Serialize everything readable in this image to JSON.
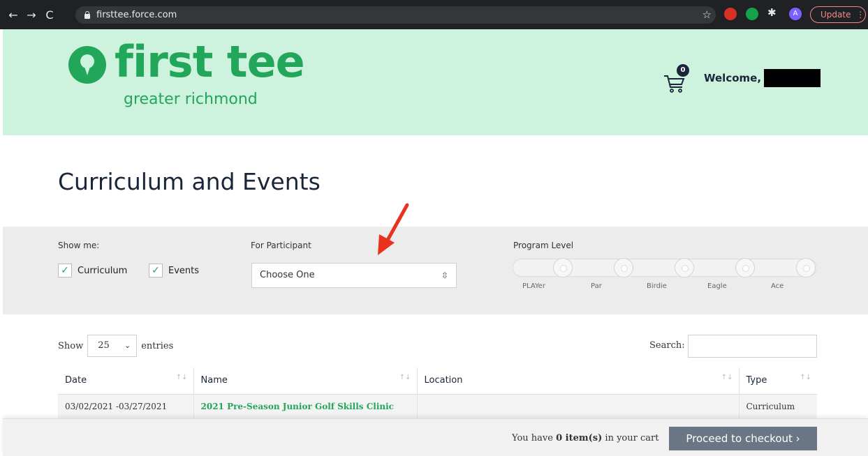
{
  "browser": {
    "url": "firsttee.force.com",
    "update_label": "Update",
    "avatar_letter": "A",
    "nav_back": "←",
    "nav_forward": "→",
    "nav_reload": "C",
    "star": "☆",
    "puzzle": "✱",
    "update_menu": "⋮"
  },
  "header": {
    "logo_text": "first tee",
    "logo_sub": "greater richmond",
    "cart_count": "0",
    "welcome": "Welcome,"
  },
  "page": {
    "title": "Curriculum and Events"
  },
  "filters": {
    "show_me_label": "Show me:",
    "curriculum_label": "Curriculum",
    "events_label": "Events",
    "participant_label": "For Participant",
    "participant_value": "Choose One",
    "program_level_label": "Program Level",
    "levels": [
      "PLAYer",
      "Par",
      "Birdie",
      "Eagle",
      "Ace"
    ],
    "check_glyph": "✓",
    "select_chevron": "⌃⌄"
  },
  "table": {
    "show_label": "Show",
    "entries_value": "25",
    "entries_label": "entries",
    "search_label": "Search:",
    "sort_glyph": "↑↓",
    "select_chevron": "⌄",
    "columns": [
      "Date",
      "Name",
      "Location",
      "Type"
    ],
    "rows": [
      {
        "date": "03/02/2021 -03/27/2021",
        "name": "2021 Pre-Season Junior Golf Skills Clinic",
        "location": "",
        "type": "Curriculum"
      }
    ]
  },
  "cart_bar": {
    "msg_prefix": "You have",
    "msg_count": "0 item(s)",
    "msg_suffix": "in your cart",
    "checkout_label": "Proceed to checkout ›"
  },
  "colors": {
    "brand_green": "#22a65a",
    "header_bg": "#cdf2de",
    "navy": "#1a2638",
    "annotation_red": "#e8321f"
  }
}
